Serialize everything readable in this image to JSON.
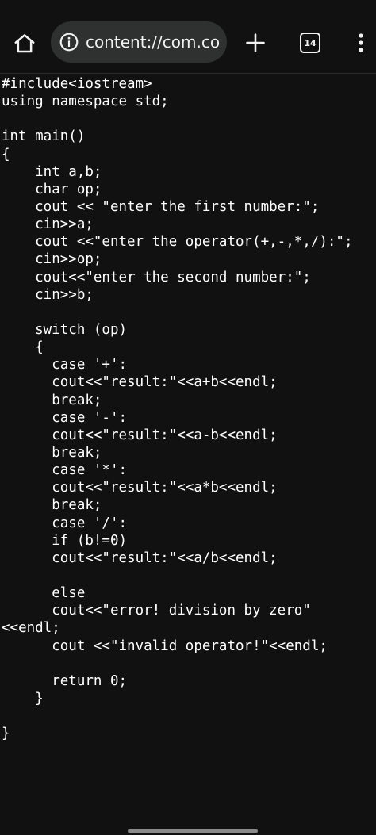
{
  "browser": {
    "address_bar": {
      "url": "content://com.co",
      "info_icon": "info-circle-icon"
    },
    "toolbar": {
      "home_icon": "home-icon",
      "new_tab_icon": "plus-icon",
      "tab_count": "14",
      "menu_icon": "kebab-menu-icon"
    }
  },
  "code": {
    "language": "cpp",
    "lines": [
      "#include<iostream>",
      "using namespace std;",
      "",
      "int main()",
      "{",
      "    int a,b;",
      "    char op;",
      "    cout << \"enter the first number:\";",
      "    cin>>a;",
      "    cout <<\"enter the operator(+,-,*,/):\";",
      "    cin>>op;",
      "    cout<<\"enter the second number:\";",
      "    cin>>b;",
      "",
      "    switch (op)",
      "    {",
      "      case '+':",
      "      cout<<\"result:\"<<a+b<<endl;",
      "      break;",
      "      case '-':",
      "      cout<<\"result:\"<<a-b<<endl;",
      "      break;",
      "      case '*':",
      "      cout<<\"result:\"<<a*b<<endl;",
      "      break;",
      "      case '/':",
      "      if (b!=0)",
      "      cout<<\"result:\"<<a/b<<endl;",
      "",
      "      else",
      "      cout<<\"error! division by zero\"",
      "<<endl;",
      "      cout <<\"invalid operator!\"<<endl;",
      "",
      "      return 0;",
      "    }",
      "",
      "}"
    ]
  },
  "colors": {
    "background": "#111111",
    "url_pill": "#2e3130",
    "text": "#ffffff",
    "gesture_bar": "#8a8a8a"
  }
}
